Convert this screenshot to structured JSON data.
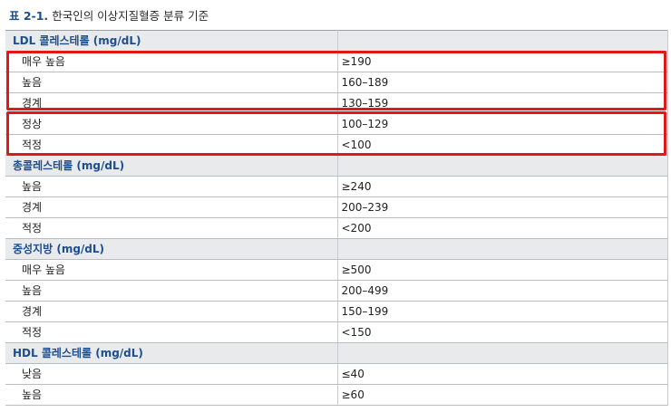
{
  "caption": {
    "label": "표 2-1.",
    "title": "한국인의 이상지질혈증 분류 기준"
  },
  "sections": [
    {
      "title": "LDL 콜레스테롤 (mg/dL)",
      "rows": [
        {
          "category": "매우 높음",
          "value": "≥190"
        },
        {
          "category": "높음",
          "value": "160–189"
        },
        {
          "category": "경계",
          "value": "130–159"
        },
        {
          "category": "정상",
          "value": "100–129"
        },
        {
          "category": "적정",
          "value": "<100"
        }
      ]
    },
    {
      "title": "총콜레스테롤 (mg/dL)",
      "rows": [
        {
          "category": "높음",
          "value": "≥240"
        },
        {
          "category": "경계",
          "value": "200–239"
        },
        {
          "category": "적정",
          "value": "<200"
        }
      ]
    },
    {
      "title": "중성지방 (mg/dL)",
      "rows": [
        {
          "category": "매우 높음",
          "value": "≥500"
        },
        {
          "category": "높음",
          "value": "200–499"
        },
        {
          "category": "경계",
          "value": "150–199"
        },
        {
          "category": "적정",
          "value": "<150"
        }
      ]
    },
    {
      "title": "HDL 콜레스테롤 (mg/dL)",
      "rows": [
        {
          "category": "낮음",
          "value": "≤40"
        },
        {
          "category": "높음",
          "value": "≥60"
        }
      ]
    }
  ],
  "colors": {
    "section_background": "#e9eaeb",
    "section_text": "#1d4e8f",
    "highlight_border": "#e01818"
  }
}
